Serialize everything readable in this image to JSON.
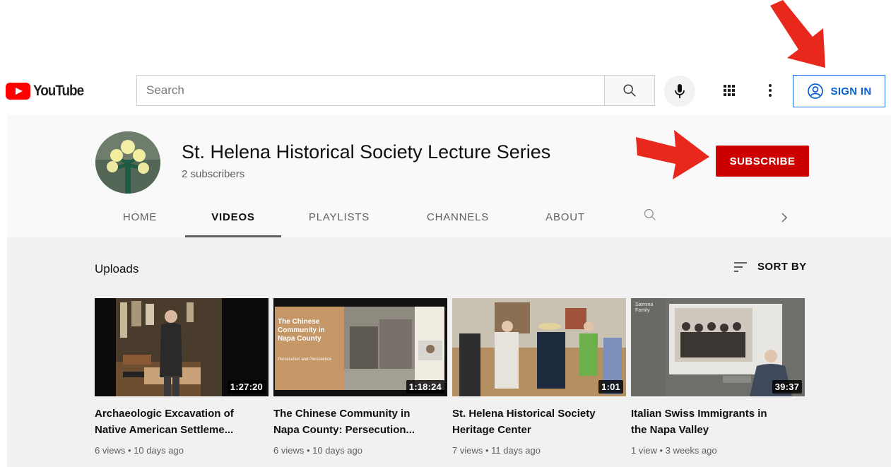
{
  "masthead": {
    "logo_text": "YouTube",
    "search_placeholder": "Search",
    "signin_label": "SIGN IN"
  },
  "channel": {
    "name": "St. Helena Historical Society Lecture Series",
    "subscribers": "2 subscribers",
    "subscribe_label": "SUBSCRIBE"
  },
  "tabs": [
    {
      "label": "HOME"
    },
    {
      "label": "VIDEOS",
      "active": true
    },
    {
      "label": "PLAYLISTS"
    },
    {
      "label": "CHANNELS"
    },
    {
      "label": "ABOUT"
    }
  ],
  "section": {
    "title": "Uploads",
    "sort_label": "SORT BY"
  },
  "videos": [
    {
      "title_line1": "Archaeologic Excavation of",
      "title_line2": "Native American Settleme...",
      "meta": "6 views • 10 days ago",
      "duration": "1:27:20"
    },
    {
      "title_line1": "The Chinese Community in",
      "title_line2": "Napa County: Persecution...",
      "meta": "6 views • 10 days ago",
      "duration": "1:18:24",
      "slide_title": "The Chinese Community in Napa County",
      "slide_subtitle": "Persecution and Persistence"
    },
    {
      "title_line1": "St. Helena Historical Society",
      "title_line2": "Heritage Center",
      "meta": "7 views • 11 days ago",
      "duration": "1:01"
    },
    {
      "title_line1": "Italian Swiss Immigrants in",
      "title_line2": "the Napa Valley",
      "meta": "1 view • 3 weeks ago",
      "duration": "39:37",
      "slide_label": "Salmina Family"
    }
  ],
  "colors": {
    "brand_red": "#ff0000",
    "subscribe_red": "#cc0000",
    "signin_blue": "#065fd4",
    "annotation_arrow": "#e8281c"
  }
}
